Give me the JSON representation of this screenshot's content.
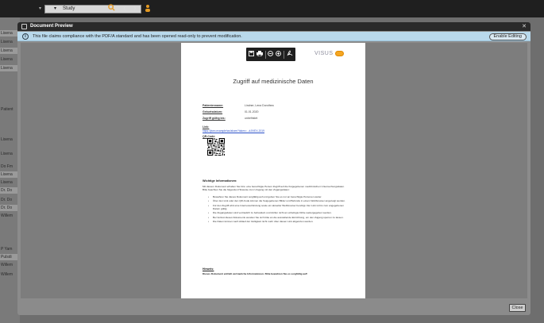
{
  "app": {
    "study_select": "Study",
    "sidebar_items": [
      "Lisena",
      "Lisena",
      "Lisena",
      "Lisena",
      "Lisena",
      "Patient",
      "Lisena",
      "Lisena",
      "Do Fm",
      "Lisena",
      "Lisena",
      "Dr. Do",
      "Dr. Do",
      "Dr. Do",
      "Willem",
      "P Yam",
      "Pulsdi",
      "Willem",
      "Willem"
    ]
  },
  "modal": {
    "title": "Document Preview",
    "info_text": "This file claims compliance with the PDF/A standard and has been opened read-only to prevent modification.",
    "enable_editing_label": "Enable Editing",
    "close_label": "Close"
  },
  "pdf": {
    "logo_text": "VISUS",
    "title": "Zugriff auf medizinische Daten",
    "fields": [
      {
        "label": "Patientenname:",
        "value": "Lindner, Lena Dorothea"
      },
      {
        "label": "Geburtsdatum:",
        "value": "01.01.2020"
      },
      {
        "label": "Zugriff gültig bis:",
        "value": "unbefristet"
      }
    ],
    "link_label": "Link:",
    "link_url": "https://jivex.example/ws/share?token=...#JIVEX-2019",
    "qr_label": "QR-Code:",
    "notes_title": "Wichtige Informationen:",
    "notes_intro": "Mit diesem Dokument erhalten Sie bzw. eine berechtigte Person Zugriff auf die freigegebenen medizinischen Untersuchungsdaten. Bitte beachten Sie die folgenden Hinweise zum Umgang mit den Zugangsdaten:",
    "bullets": [
      "Bewahren Sie dieses Dokument sorgfältig auf und geben Sie es nur an berechtigte Personen weiter.",
      "Über den Link oder den QR-Code können die freigegebenen Bilder und Befunde in einem Webbrowser angezeigt werden.",
      "Für den Zugriff wird eine Internetverbindung sowie ein aktueller Webbrowser benötigt. Der Link ist bis zum angegebenen Datum gültig.",
      "Die Zugangsdaten sind vertraulich zu behandeln und dürfen nicht an unbefugte Dritte weitergegeben werden.",
      "Bei Verlust dieses Dokuments wenden Sie sich bitte an die ausstellende Einrichtung, um den Zugang sperren zu lassen.",
      "Die Daten können nach Ablauf der Gültigkeit nicht mehr über diesen Link abgerufen werden."
    ],
    "hint_title": "Hinweis:",
    "hint_text": "Dieses Dokument enthält vertrauliche Informationen. Bitte bewahren Sie es sorgfältig auf!"
  }
}
